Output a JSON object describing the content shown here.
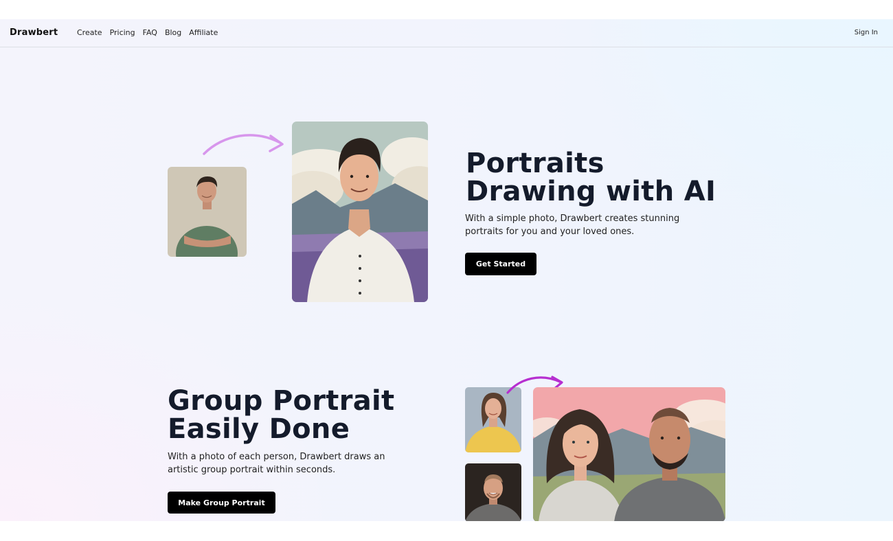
{
  "nav": {
    "brand": "Drawbert",
    "links": [
      "Create",
      "Pricing",
      "FAQ",
      "Blog",
      "Affiliate"
    ],
    "sign_in": "Sign In"
  },
  "hero": {
    "title_line1": "Portraits",
    "title_line2": "Drawing with AI",
    "description_line1": "With a simple photo, Drawbert creates stunning",
    "description_line2": "portraits for you and your loved ones.",
    "cta": "Get Started"
  },
  "group": {
    "title_line1": "Group Portrait",
    "title_line2": "Easily Done",
    "description_line1": "With a photo of each person, Drawbert draws an",
    "description_line2": "artistic group portrait within seconds.",
    "cta": "Make Group Portrait"
  },
  "colors": {
    "arrow_light": "#d796ec",
    "arrow_dark": "#b62fd0",
    "heading": "#141b2b",
    "button": "#000000"
  }
}
